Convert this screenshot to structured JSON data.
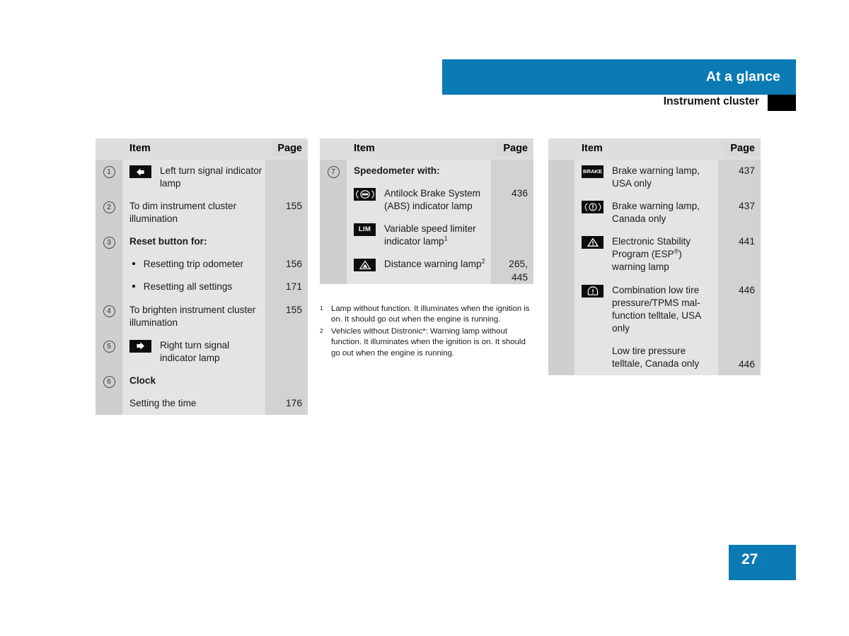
{
  "header": {
    "title": "At a glance",
    "subtitle": "Instrument cluster",
    "band_color": "#0b7ab5",
    "marker_color": "#000000"
  },
  "page_number": "27",
  "columns": {
    "headers": {
      "item": "Item",
      "page": "Page"
    },
    "left": [
      {
        "num": "1",
        "icon": "left-turn-signal-icon",
        "text": "Left turn signal indicator lamp",
        "page": ""
      },
      {
        "num": "2",
        "icon": "",
        "text": "To dim instrument cluster illumination",
        "page": "155"
      },
      {
        "num": "3",
        "icon": "",
        "text": "Reset button for:",
        "page": "",
        "bold": true
      },
      {
        "num": "",
        "icon": "",
        "bullet": true,
        "text": "Resetting trip odometer",
        "page": "156"
      },
      {
        "num": "",
        "icon": "",
        "bullet": true,
        "text": "Resetting all settings",
        "page": "171"
      },
      {
        "num": "4",
        "icon": "",
        "text": "To brighten instrument cluster illumination",
        "page": "155"
      },
      {
        "num": "5",
        "icon": "right-turn-signal-icon",
        "text": "Right turn signal indicator lamp",
        "page": ""
      },
      {
        "num": "6",
        "icon": "",
        "text": "Clock",
        "page": "",
        "bold": true
      },
      {
        "num": "",
        "icon": "",
        "text": "Setting the time",
        "page": "176"
      }
    ],
    "middle": [
      {
        "num": "7",
        "icon": "",
        "text": "Speedometer with:",
        "page": "",
        "bold": true
      },
      {
        "num": "",
        "icon": "abs-icon",
        "text": "Antilock Brake System (ABS) indicator lamp",
        "page": "436"
      },
      {
        "num": "",
        "icon": "lim-icon",
        "text": "Variable speed limiter indicator lamp",
        "footnote": "1",
        "page": ""
      },
      {
        "num": "",
        "icon": "distance-warning-icon",
        "text": "Distance warning lamp",
        "footnote": "2",
        "page": "265,\n445"
      }
    ],
    "right": [
      {
        "icon": "brake-usa-icon",
        "text": "Brake warning lamp, USA only",
        "page": "437"
      },
      {
        "icon": "brake-canada-icon",
        "text": "Brake warning lamp, Canada only",
        "page": "437"
      },
      {
        "icon": "esp-warning-icon",
        "text": "Electronic Stability Program (ESP®) warning lamp",
        "page": "441"
      },
      {
        "icon": "tpms-icon",
        "text": "Combination low tire pressure/TPMS mal-function telltale, USA only",
        "page": "446"
      },
      {
        "icon": "",
        "text": "Low tire pressure telltale, Canada only",
        "page": "446"
      }
    ]
  },
  "icon_labels": {
    "lim": "LIM",
    "brake": "BRAKE",
    "abs": "ABS"
  },
  "footnotes": [
    {
      "mark": "1",
      "text": "Lamp without function. It illuminates when the ignition is on. It should go out when the engine is running."
    },
    {
      "mark": "2",
      "text": "Vehicles without Distronic*: Warning lamp without function. It illuminates when the ignition is on. It should go out when the engine is running."
    }
  ],
  "cells": {
    "l0_text": "Left turn signal indicator lamp",
    "l1_text": "To dim instrument cluster illumination",
    "l1_page": "155",
    "l2_text": "Reset button for:",
    "l3_text": "Resetting trip odometer",
    "l3_page": "156",
    "l4_text": "Resetting all settings",
    "l4_page": "171",
    "l5_text": "To brighten instrument cluster illumination",
    "l5_page": "155",
    "l6_text": "Right turn signal indicator lamp",
    "l7_text": "Clock",
    "l8_text": "Setting the time",
    "l8_page": "176",
    "m0_text": "Speedometer with:",
    "m1_text": "Antilock Brake System (ABS) indicator lamp",
    "m1_page": "436",
    "m2_text": "Variable speed limiter indicator lamp",
    "m3_text": "Distance warning lamp",
    "m3_page_a": "265,",
    "m3_page_b": "445",
    "r0_text": "Brake warning lamp, USA only",
    "r0_page": "437",
    "r1_text": "Brake warning lamp, Canada only",
    "r1_page": "437",
    "r2_text_a": "Electronic Stability Program (ESP",
    "r2_text_b": ") warning lamp",
    "r2_reg": "®",
    "r2_page": "441",
    "r3_text": "Combination low tire pressure/TPMS mal-function telltale, USA only",
    "r3_page": "446",
    "r4_text": "Low tire pressure telltale, Canada only",
    "r4_page": "446"
  },
  "marks": {
    "one": "1",
    "two": "2"
  },
  "numbers": {
    "n1": "1",
    "n2": "2",
    "n3": "3",
    "n4": "4",
    "n5": "5",
    "n6": "6",
    "n7": "7"
  }
}
